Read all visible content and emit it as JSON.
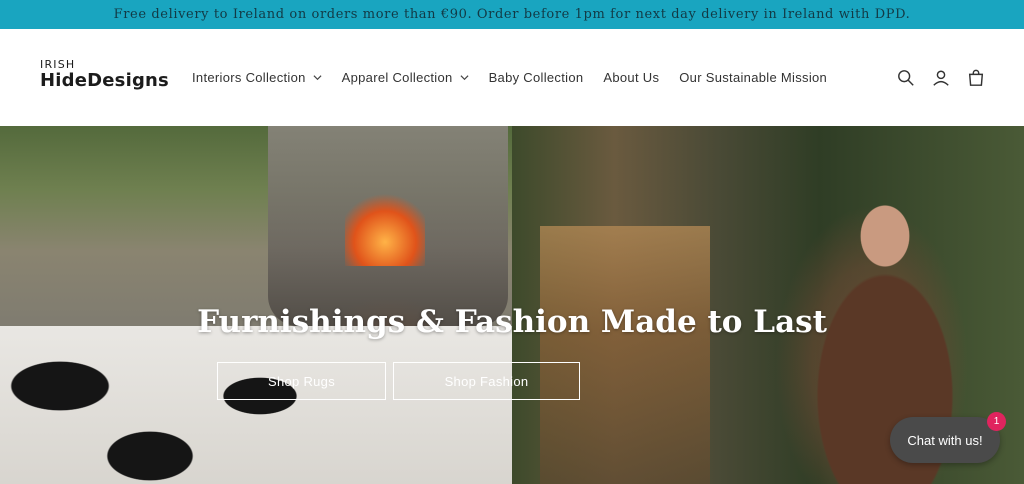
{
  "announcement": {
    "text": "Free delivery to Ireland on orders more than €90. Order before 1pm for next day delivery in Ireland with DPD."
  },
  "header": {
    "logo_small": "IRISH",
    "logo_big": "HideDesigns",
    "nav": [
      {
        "label": "Interiors Collection",
        "has_dropdown": true
      },
      {
        "label": "Apparel Collection",
        "has_dropdown": true
      },
      {
        "label": "Baby Collection",
        "has_dropdown": false
      },
      {
        "label": "About Us",
        "has_dropdown": false
      },
      {
        "label": "Our Sustainable Mission",
        "has_dropdown": false
      }
    ],
    "icons": [
      "search-icon",
      "account-icon",
      "cart-icon"
    ]
  },
  "hero": {
    "title": "Furnishings & Fashion Made to Last",
    "buttons": [
      "Shop Rugs",
      "Shop Fashion"
    ]
  },
  "chat": {
    "label": "Chat with us!",
    "badge": "1"
  },
  "colors": {
    "announcement_bg": "#19a5c0",
    "chat_bg": "#4a4a4a",
    "badge_bg": "#e0245e"
  }
}
